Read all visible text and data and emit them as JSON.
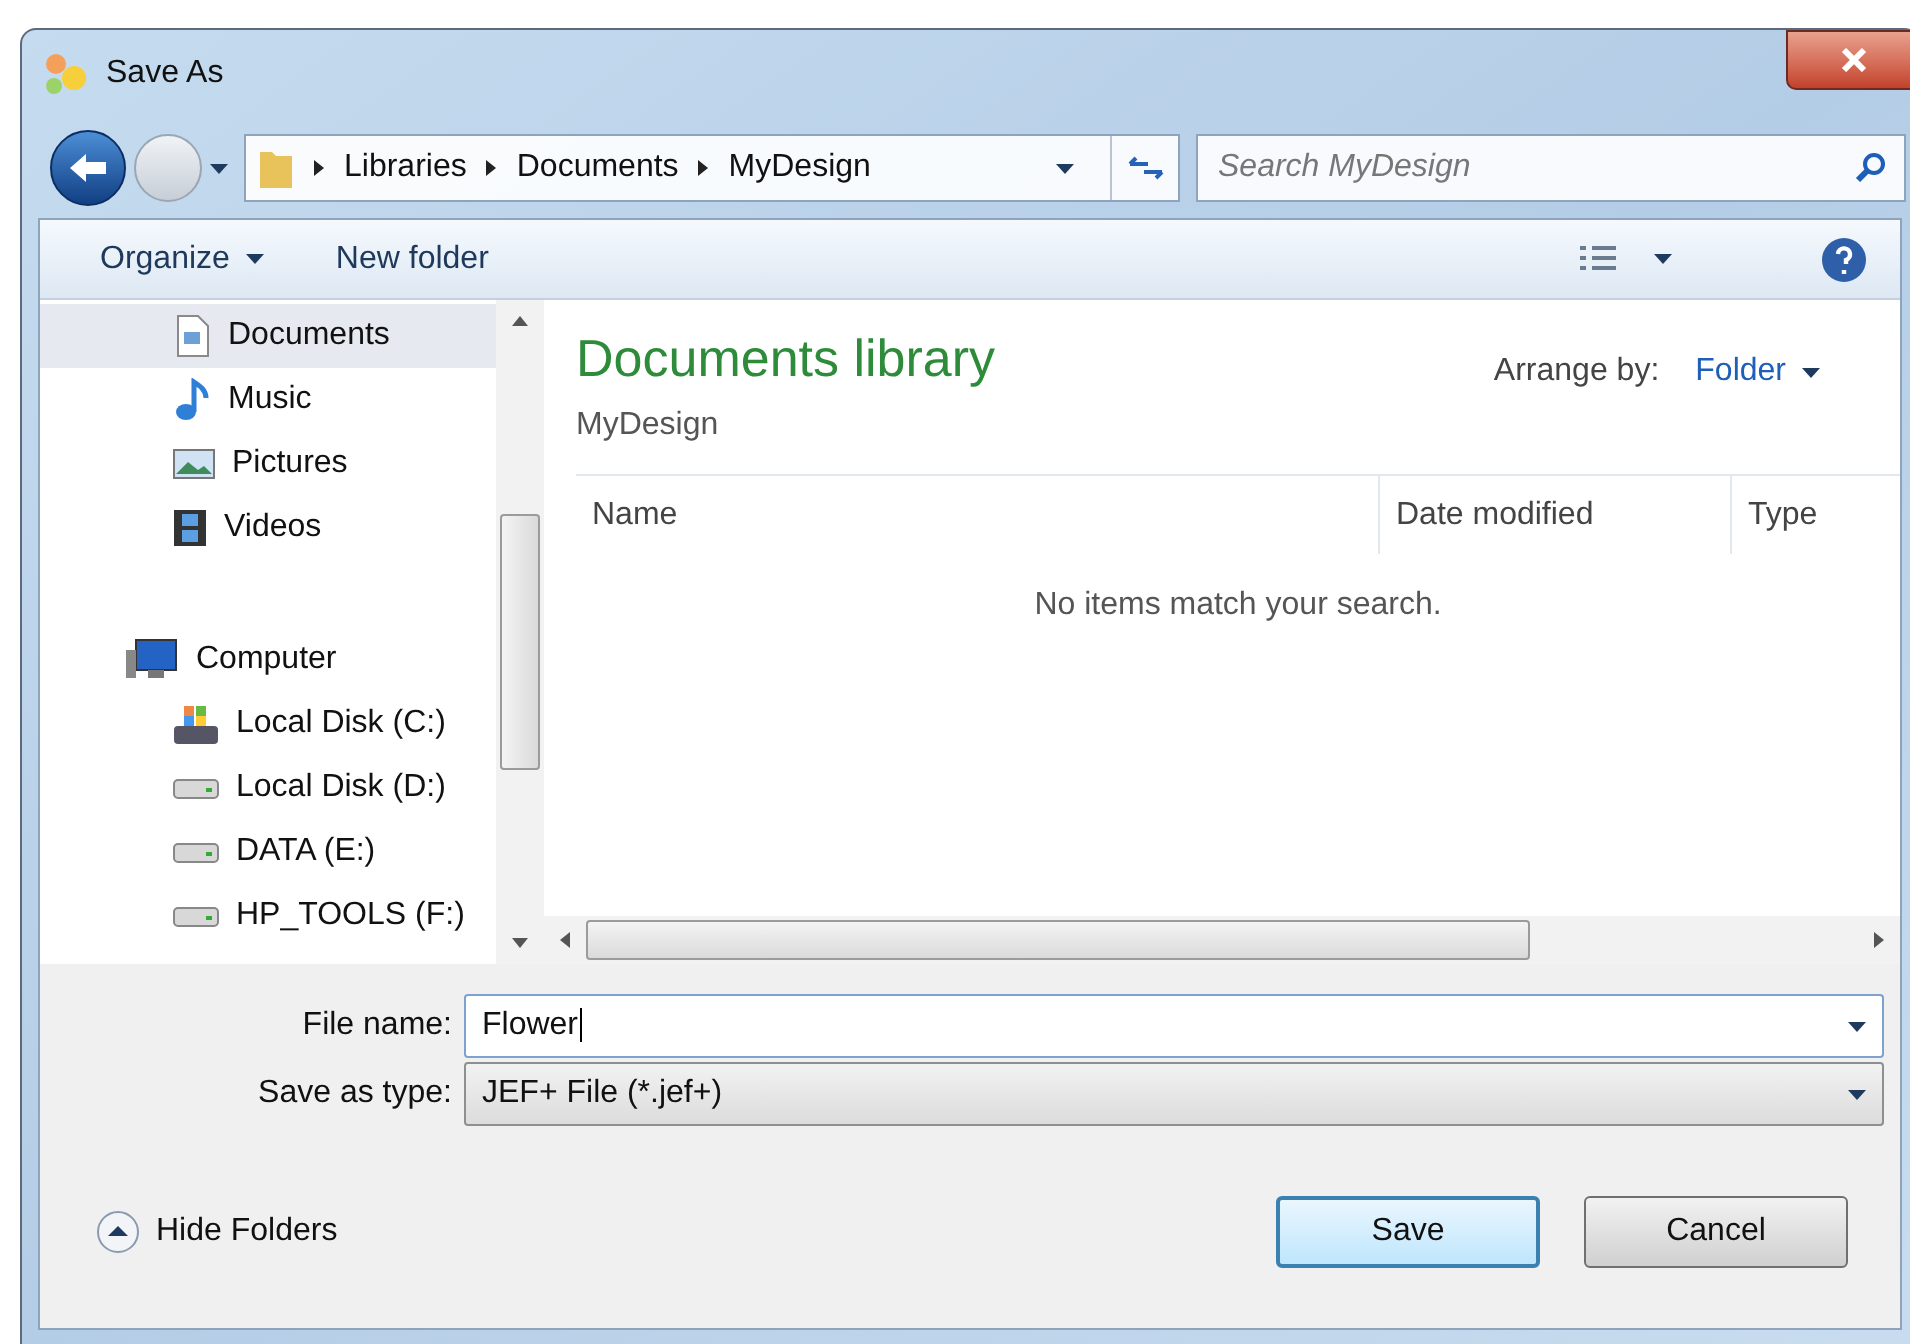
{
  "window": {
    "title": "Save As"
  },
  "address": {
    "breadcrumbs": [
      "Libraries",
      "Documents",
      "MyDesign"
    ]
  },
  "search": {
    "placeholder": "Search MyDesign"
  },
  "toolbar": {
    "organize": "Organize",
    "new_folder": "New folder"
  },
  "sidebar": {
    "items": [
      {
        "label": "Documents",
        "kind": "documents",
        "selected": true
      },
      {
        "label": "Music",
        "kind": "music",
        "selected": false
      },
      {
        "label": "Pictures",
        "kind": "pictures",
        "selected": false
      },
      {
        "label": "Videos",
        "kind": "videos",
        "selected": false
      }
    ],
    "computer": {
      "label": "Computer",
      "children": [
        {
          "label": "Local Disk (C:)",
          "kind": "system-drive",
          "selected": false
        },
        {
          "label": "Local Disk (D:)",
          "kind": "drive",
          "selected": false
        },
        {
          "label": "DATA (E:)",
          "kind": "drive",
          "selected": false
        },
        {
          "label": "HP_TOOLS (F:)",
          "kind": "drive",
          "selected": false
        }
      ]
    }
  },
  "library": {
    "title": "Documents library",
    "subtitle": "MyDesign",
    "arrange_label": "Arrange by:",
    "arrange_value": "Folder",
    "columns": [
      "Name",
      "Date modified",
      "Type"
    ],
    "empty_message": "No items match your search."
  },
  "file_name": {
    "label": "File name:",
    "value": "Flower"
  },
  "save_type": {
    "label": "Save as type:",
    "value": "JEF+ File (*.jef+)"
  },
  "hide_folders": "Hide Folders",
  "buttons": [
    {
      "label": "Save",
      "default": true
    },
    {
      "label": "Cancel",
      "default": false
    }
  ]
}
